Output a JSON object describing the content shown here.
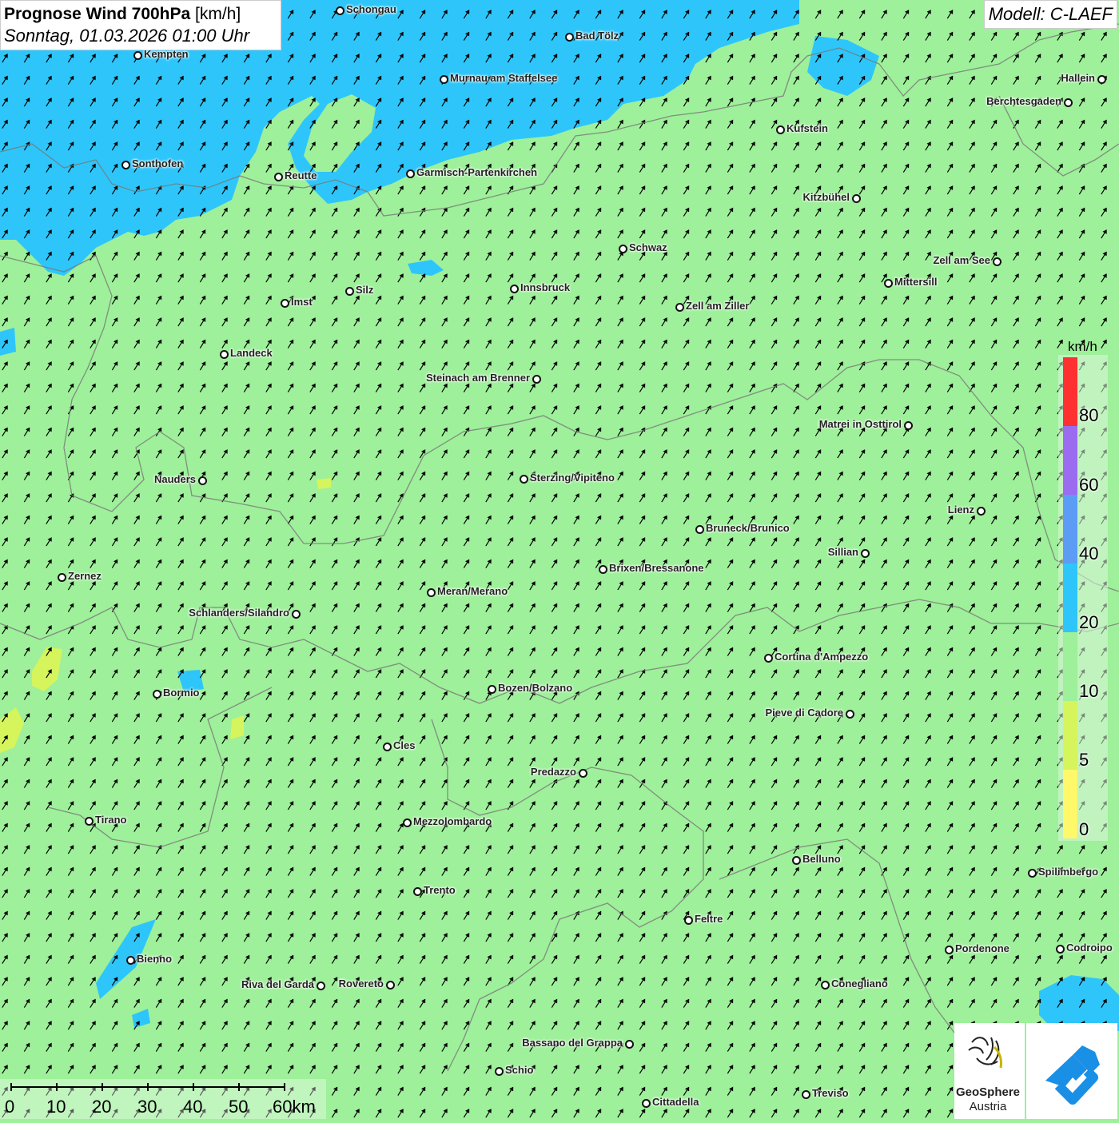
{
  "header": {
    "title_bold": "Prognose Wind 700hPa",
    "title_unit": "[km/h]",
    "date": "Sonntag, 01.03.2026 01:00 Uhr"
  },
  "model": "Modell: C-LAEF",
  "legend": {
    "unit": "km/h",
    "labels": [
      "80",
      "60",
      "40",
      "20",
      "10",
      "5",
      "0"
    ],
    "colors": [
      "#ff3030",
      "#9b6cf0",
      "#5c9cf4",
      "#2ec6fa",
      "#9ef09a",
      "#d6f45c",
      "#fff86a"
    ]
  },
  "scale": {
    "labels": [
      "0",
      "10",
      "20",
      "30",
      "40",
      "50",
      "60km"
    ]
  },
  "logos": {
    "geosphere": "GeoSphere",
    "austria": "Austria"
  },
  "cities": [
    {
      "name": "Schongau"
    },
    {
      "name": "Bad Tölz"
    },
    {
      "name": "Kempten"
    },
    {
      "name": "Murnau am Staffelsee"
    },
    {
      "name": "Hallein"
    },
    {
      "name": "Berchtesgaden"
    },
    {
      "name": "Kufstein"
    },
    {
      "name": "Sonthofen"
    },
    {
      "name": "Reutte"
    },
    {
      "name": "Garmisch-Partenkirchen"
    },
    {
      "name": "Kitzbühel"
    },
    {
      "name": "Schwaz"
    },
    {
      "name": "Zell am See"
    },
    {
      "name": "Mittersill"
    },
    {
      "name": "Innsbruck"
    },
    {
      "name": "Silz"
    },
    {
      "name": "Imst"
    },
    {
      "name": "Zell am Ziller"
    },
    {
      "name": "Landeck"
    },
    {
      "name": "Steinach am Brenner"
    },
    {
      "name": "Matrei in Osttirol"
    },
    {
      "name": "Nauders"
    },
    {
      "name": "Sterzing/Vipiteno"
    },
    {
      "name": "Lienz"
    },
    {
      "name": "Bruneck/Brunico"
    },
    {
      "name": "Sillian"
    },
    {
      "name": "Brixen/Bressanone"
    },
    {
      "name": "Zernez"
    },
    {
      "name": "Meran/Merano"
    },
    {
      "name": "Schlanders/Silandro"
    },
    {
      "name": "Cortina d'Ampezzo"
    },
    {
      "name": "Bozen/Bolzano"
    },
    {
      "name": "Bormio"
    },
    {
      "name": "Pieve di Cadore"
    },
    {
      "name": "Cles"
    },
    {
      "name": "Predazzo"
    },
    {
      "name": "Tirano"
    },
    {
      "name": "Mezzolombardo"
    },
    {
      "name": "Belluno"
    },
    {
      "name": "Spilimbergo"
    },
    {
      "name": "Trento"
    },
    {
      "name": "Feltre"
    },
    {
      "name": "Pordenone"
    },
    {
      "name": "Codroipo"
    },
    {
      "name": "Bienno"
    },
    {
      "name": "Riva del Garda"
    },
    {
      "name": "Rovereto"
    },
    {
      "name": "Conegliano"
    },
    {
      "name": "Bassano del Grappa"
    },
    {
      "name": "Schio"
    },
    {
      "name": "Treviso"
    },
    {
      "name": "Cittadella"
    }
  ]
}
